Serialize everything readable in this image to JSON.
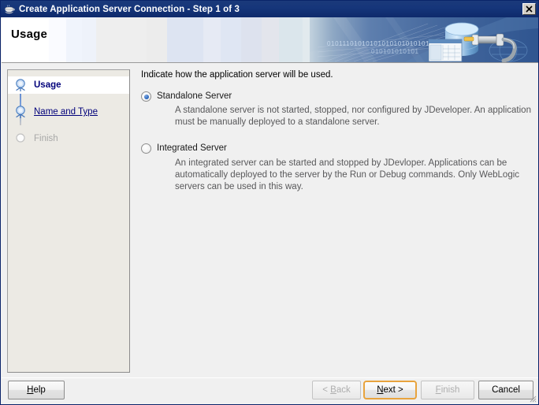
{
  "window": {
    "title": "Create Application Server Connection - Step 1 of 3",
    "icon": "java-cup-icon",
    "close_label": "✕"
  },
  "banner": {
    "title": "Usage",
    "art": "database-connection-graphic",
    "binary_text": "0101011010101010101010101010101010"
  },
  "sidebar": {
    "items": [
      {
        "label": "Usage",
        "state": "current",
        "icon": "wizard-step-node-icon"
      },
      {
        "label": "Name and Type",
        "state": "link",
        "icon": "wizard-step-node-icon"
      },
      {
        "label": "Finish",
        "state": "disabled",
        "icon": "wizard-step-empty-icon"
      }
    ]
  },
  "main": {
    "prompt": "Indicate how the application server will be used.",
    "options": [
      {
        "label": "Standalone Server",
        "selected": true,
        "description": "A standalone server is not started, stopped, nor configured by JDeveloper. An application must be manually deployed to a standalone server."
      },
      {
        "label": "Integrated Server",
        "selected": false,
        "description": "An integrated server can be started and stopped by JDevloper. Applications can be automatically deployed to the server by the Run or Debug commands. Only WebLogic servers can be used in this way."
      }
    ]
  },
  "buttons": {
    "help": {
      "label": "Help",
      "mnemonic": "H",
      "disabled": false,
      "focused": false
    },
    "back": {
      "label": "< Back",
      "mnemonic": "B",
      "disabled": true,
      "focused": false
    },
    "next": {
      "label": "Next >",
      "mnemonic": "N",
      "disabled": false,
      "focused": true
    },
    "finish": {
      "label": "Finish",
      "mnemonic": "F",
      "disabled": true,
      "focused": false
    },
    "cancel": {
      "label": "Cancel",
      "mnemonic": "",
      "disabled": false,
      "focused": false
    }
  },
  "colors": {
    "titlebar": "#15357a",
    "banner_blue": "#3a6ea5",
    "link": "#00007a",
    "focus_ring": "#e8a33d",
    "sidebar_bg": "#eceae4"
  }
}
